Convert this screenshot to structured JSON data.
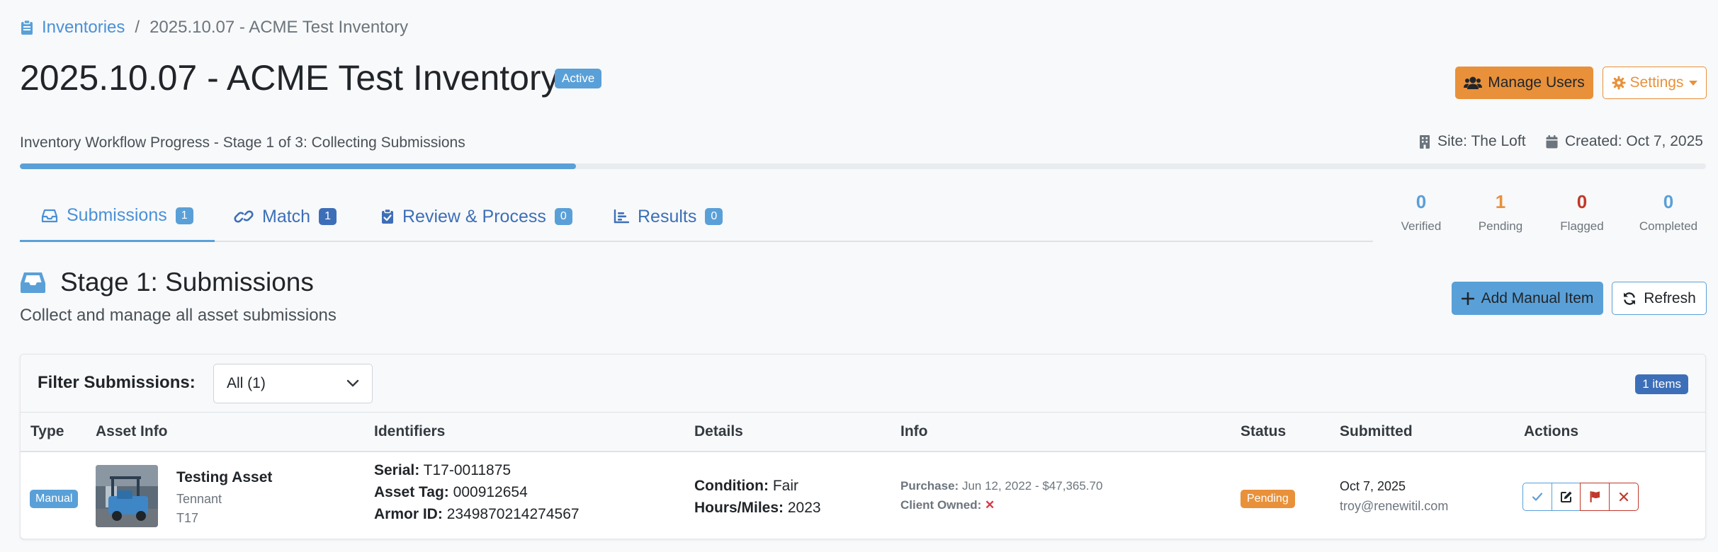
{
  "breadcrumb": {
    "link": "Inventories",
    "separator": "/",
    "current": "2025.10.07 - ACME Test Inventory"
  },
  "header": {
    "title": "2025.10.07 - ACME Test Inventory",
    "status_badge": "Active",
    "manage_users_label": "Manage Users",
    "settings_label": "Settings"
  },
  "workflow": {
    "label": "Inventory Workflow Progress - Stage 1 of 3: Collecting Submissions",
    "progress_percent": 33,
    "site": "Site: The Loft",
    "created": "Created: Oct 7, 2025"
  },
  "tabs": [
    {
      "label": "Submissions",
      "count": "1",
      "active": true,
      "count_color": "#5aa0d8"
    },
    {
      "label": "Match",
      "count": "1",
      "active": false,
      "count_color": "#3d6fb8"
    },
    {
      "label": "Review & Process",
      "count": "0",
      "active": false,
      "count_color": "#5aa0d8"
    },
    {
      "label": "Results",
      "count": "0",
      "active": false,
      "count_color": "#5aa0d8"
    }
  ],
  "stats": [
    {
      "value": "0",
      "label": "Verified",
      "color": "#5aa0d8"
    },
    {
      "value": "1",
      "label": "Pending",
      "color": "#e8913a"
    },
    {
      "value": "0",
      "label": "Flagged",
      "color": "#c0392b"
    },
    {
      "value": "0",
      "label": "Completed",
      "color": "#5aa0d8"
    }
  ],
  "stage": {
    "title": "Stage 1: Submissions",
    "subtitle": "Collect and manage all asset submissions",
    "add_label": "Add Manual Item",
    "refresh_label": "Refresh"
  },
  "filter": {
    "label": "Filter Submissions:",
    "selected": "All (1)",
    "items_badge": "1 items"
  },
  "table": {
    "headers": [
      "Type",
      "Asset Info",
      "Identifiers",
      "Details",
      "Info",
      "Status",
      "Submitted",
      "Actions"
    ],
    "rows": [
      {
        "type": "Manual",
        "asset_name": "Testing Asset",
        "asset_make": "Tennant",
        "asset_model": "T17",
        "serial_label": "Serial:",
        "serial": "T17-0011875",
        "asset_tag_label": "Asset Tag:",
        "asset_tag": "000912654",
        "armor_id_label": "Armor ID:",
        "armor_id": "2349870214274567",
        "condition_label": "Condition:",
        "condition": "Fair",
        "hours_label": "Hours/Miles:",
        "hours": "2023",
        "purchase_label": "Purchase:",
        "purchase": "Jun 12, 2022 - $47,365.70",
        "client_owned_label": "Client Owned:",
        "client_owned": "✕",
        "status": "Pending",
        "submitted_date": "Oct 7, 2025",
        "submitted_by": "troy@renewitil.com"
      }
    ]
  },
  "colors": {
    "primary": "#5aa0d8",
    "warning": "#e8913a",
    "danger": "#c0392b",
    "dark_blue": "#3d6fb8"
  },
  "icons": [
    "clipboard-icon",
    "users-icon",
    "gear-icon",
    "building-icon",
    "calendar-icon",
    "inbox-icon",
    "link-icon",
    "clipboard-check-icon",
    "bar-chart-icon",
    "plus-icon",
    "refresh-icon",
    "chevron-down-icon",
    "check-icon",
    "edit-icon",
    "flag-icon",
    "close-icon"
  ]
}
